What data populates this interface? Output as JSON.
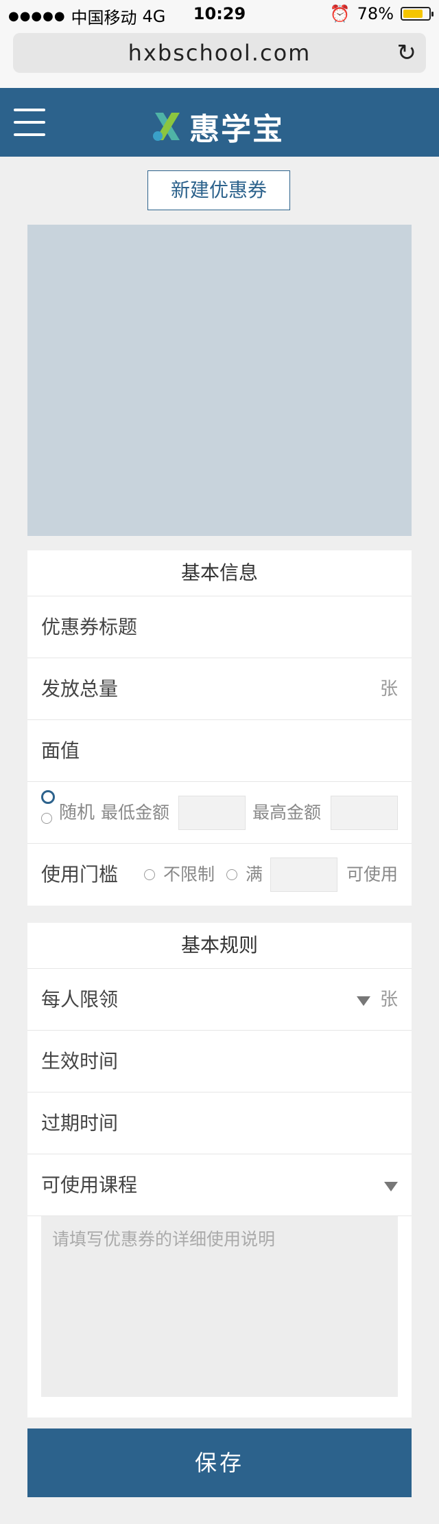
{
  "status_bar": {
    "signal": "●●●●●",
    "carrier": "中国移动",
    "network": "4G",
    "time": "10:29",
    "alarm_icon": "alarm-icon",
    "battery_percent": "78%",
    "battery_level": 0.78
  },
  "browser": {
    "url": "hxbschool.com",
    "reload_icon": "reload-icon"
  },
  "header": {
    "brand": "惠学宝",
    "menu_icon": "hamburger-icon",
    "brand_color": "#2c628c"
  },
  "new_coupon_button": "新建优惠券",
  "basic_info": {
    "title": "基本信息",
    "coupon_title_label": "优惠券标题",
    "total_label": "发放总量",
    "total_unit": "张",
    "face_value_label": "面值",
    "random_label": "随机",
    "min_amount_label": "最低金额",
    "max_amount_label": "最高金额",
    "threshold_label": "使用门槛",
    "unlimited_label": "不限制",
    "full_label": "满",
    "usable_label": "可使用"
  },
  "basic_rules": {
    "title": "基本规则",
    "per_person_label": "每人限领",
    "per_person_unit": "张",
    "effective_time_label": "生效时间",
    "expire_time_label": "过期时间",
    "courses_label": "可使用课程",
    "description_placeholder": "请填写优惠券的详细使用说明"
  },
  "save_button": "保存"
}
